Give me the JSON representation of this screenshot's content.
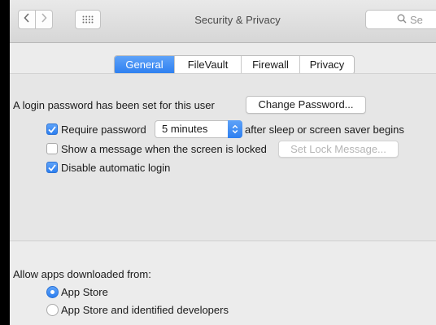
{
  "window": {
    "title": "Security & Privacy",
    "search_placeholder": "Search",
    "search_visible_text": "Se"
  },
  "tabs": [
    {
      "label": "General",
      "selected": true
    },
    {
      "label": "FileVault",
      "selected": false
    },
    {
      "label": "Firewall",
      "selected": false
    },
    {
      "label": "Privacy",
      "selected": false
    }
  ],
  "general": {
    "login_password_text": "A login password has been set for this user",
    "change_password_label": "Change Password...",
    "require_password": {
      "label": "Require password",
      "checked": true,
      "delay_value": "5 minutes",
      "suffix": "after sleep or screen saver begins"
    },
    "show_message": {
      "label": "Show a message when the screen is locked",
      "checked": false,
      "button_label": "Set Lock Message..."
    },
    "disable_auto_login": {
      "label": "Disable automatic login",
      "checked": true
    }
  },
  "allow_apps": {
    "heading": "Allow apps downloaded from:",
    "options": [
      {
        "label": "App Store",
        "selected": true
      },
      {
        "label": "App Store and identified developers",
        "selected": false
      }
    ]
  },
  "colors": {
    "accent": "#2d7ff0",
    "window_bg": "#ececec"
  }
}
